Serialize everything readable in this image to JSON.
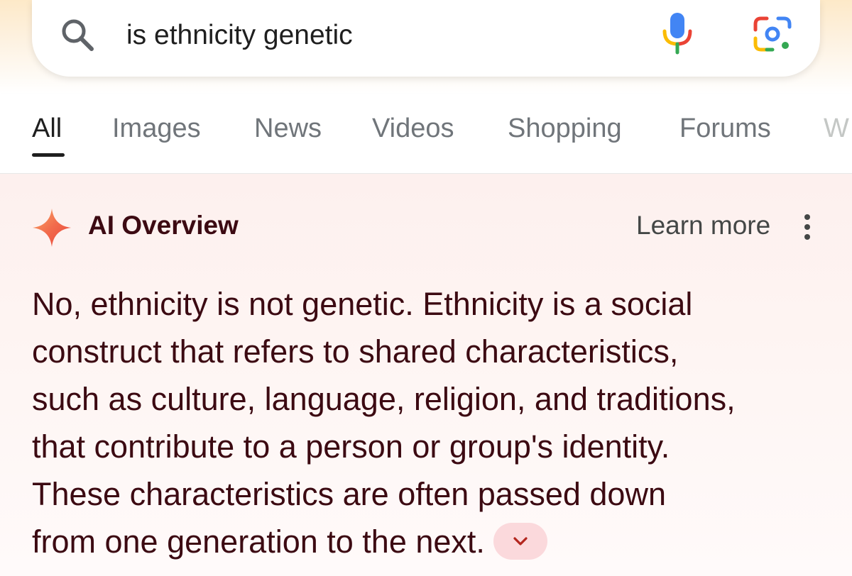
{
  "search": {
    "query": "is ethnicity genetic",
    "icons": [
      "search-icon",
      "mic-icon",
      "google-lens-icon"
    ]
  },
  "tabs": [
    {
      "label": "All",
      "active": true
    },
    {
      "label": "Images",
      "active": false
    },
    {
      "label": "News",
      "active": false
    },
    {
      "label": "Videos",
      "active": false
    },
    {
      "label": "Shopping",
      "active": false
    },
    {
      "label": "Forums",
      "active": false
    },
    {
      "label": "W",
      "active": false
    }
  ],
  "overview": {
    "title": "AI Overview",
    "learn_more": "Learn more",
    "answer_lines": [
      "No, ethnicity is not genetic. Ethnicity is a social",
      "construct that refers to shared characteristics,",
      "such as culture, language, religion, and traditions,",
      "that contribute to a person or group's identity.",
      "These characteristics are often passed down",
      "from one generation to the next."
    ],
    "icons": [
      "sparkle-icon",
      "more-vert-icon",
      "chevron-down-icon"
    ]
  },
  "colors": {
    "overview_text": "#3c0a12",
    "tab_inactive": "#70757a",
    "tab_active": "#1f1f1f",
    "chip_bg": "#fbd9dc",
    "google_blue": "#4285f4",
    "google_red": "#ea4335",
    "google_yellow": "#fbbc05",
    "google_green": "#34a853"
  }
}
